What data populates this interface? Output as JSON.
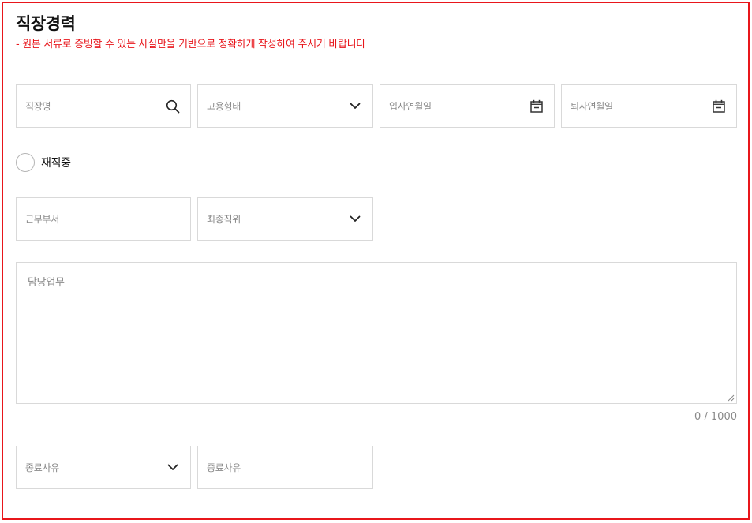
{
  "section": {
    "title": "직장경력",
    "subtitle": "- 원본 서류로 증빙할 수 있는 사실만을 기반으로 정확하게 작성하여 주시기 바랍니다"
  },
  "fields": {
    "company_name": {
      "placeholder": "직장명",
      "icon": "search-icon"
    },
    "employment_type": {
      "placeholder": "고용형태",
      "icon": "chevron-down-icon"
    },
    "join_date": {
      "placeholder": "입사연월일",
      "icon": "calendar-icon"
    },
    "leave_date": {
      "placeholder": "퇴사연월일",
      "icon": "calendar-icon"
    },
    "currently_employed": {
      "label": "재직중",
      "checked": false
    },
    "department": {
      "placeholder": "근무부서"
    },
    "final_position": {
      "placeholder": "최종직위",
      "icon": "chevron-down-icon"
    },
    "duties": {
      "placeholder": "담당업무",
      "counter": "0 / 1000"
    },
    "leave_reason_select": {
      "placeholder": "종료사유",
      "icon": "chevron-down-icon"
    },
    "leave_reason_text": {
      "placeholder": "종료사유"
    }
  },
  "colors": {
    "accent": "#e8161b",
    "border": "#d9d9d9",
    "placeholder": "#8a8a8a"
  }
}
